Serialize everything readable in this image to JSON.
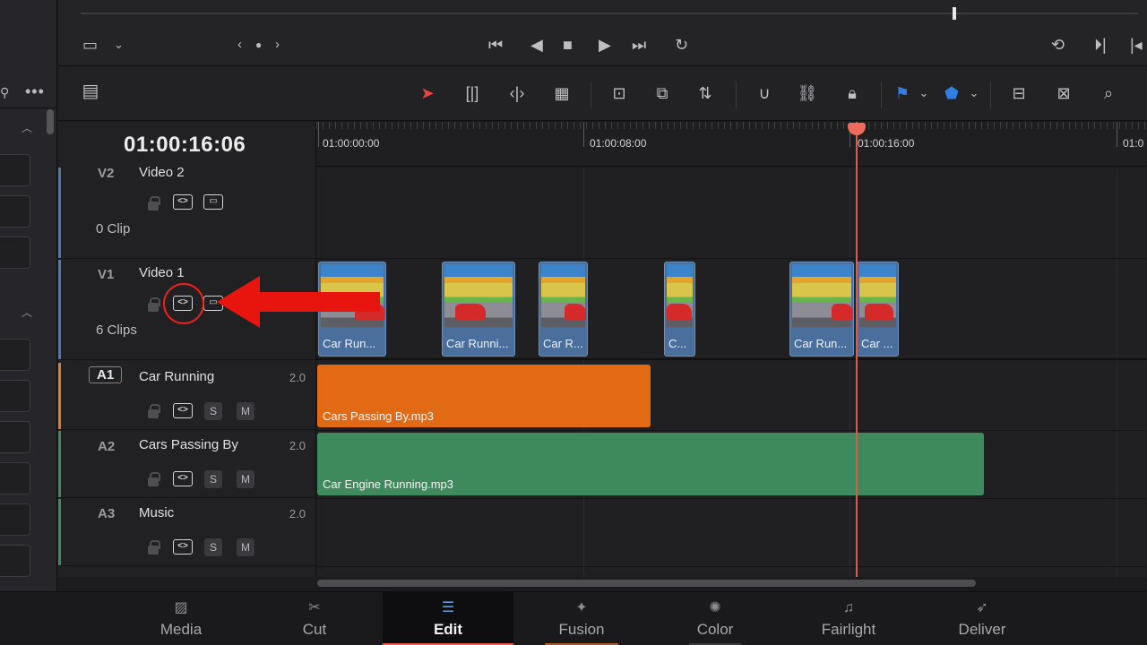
{
  "timecode": "01:00:16:06",
  "ruler": {
    "labels": [
      "01:00:00:00",
      "01:00:08:00",
      "01:00:16:00",
      "01:0"
    ]
  },
  "tracks": {
    "v2": {
      "id": "V2",
      "name": "Video 2",
      "count": "0 Clip"
    },
    "v1": {
      "id": "V1",
      "name": "Video 1",
      "count": "6 Clips"
    },
    "a1": {
      "id": "A1",
      "name": "Car Running",
      "volume": "2.0"
    },
    "a2": {
      "id": "A2",
      "name": "Cars Passing By",
      "volume": "2.0"
    },
    "a3": {
      "id": "A3",
      "name": "Music",
      "volume": "2.0"
    },
    "solo_label": "S",
    "mute_label": "M"
  },
  "video_clips": [
    {
      "label": "Car Run..."
    },
    {
      "label": "Car Runni..."
    },
    {
      "label": "Car R..."
    },
    {
      "label": "C..."
    },
    {
      "label": "Car Run..."
    },
    {
      "label": "Car ..."
    }
  ],
  "audio_clips": {
    "a1": {
      "label": "Cars Passing By.mp3",
      "color": "#e26a14"
    },
    "a2": {
      "label": "Car Engine Running.mp3",
      "color": "#3f8a5d"
    }
  },
  "track_colors": {
    "video": "#4a78b0",
    "audio1": "#e07a2e",
    "audio2": "#3f8a5d"
  },
  "bottom_nav": {
    "media": "Media",
    "cut": "Cut",
    "edit": "Edit",
    "fusion": "Fusion",
    "color": "Color",
    "fairlight": "Fairlight",
    "deliver": "Deliver",
    "active": "Edit"
  }
}
